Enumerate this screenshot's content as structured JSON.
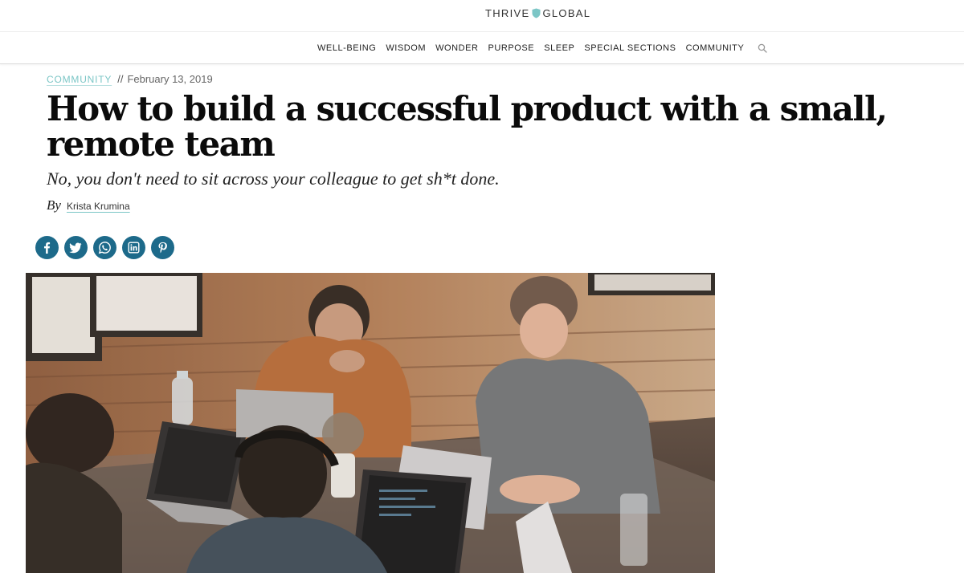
{
  "header": {
    "logo_left": "THRIVE",
    "logo_right": "GLOBAL"
  },
  "nav": {
    "items": [
      {
        "label": "WELL-BEING"
      },
      {
        "label": "WISDOM"
      },
      {
        "label": "WONDER"
      },
      {
        "label": "PURPOSE"
      },
      {
        "label": "SLEEP"
      },
      {
        "label": "SPECIAL SECTIONS"
      },
      {
        "label": "COMMUNITY"
      }
    ],
    "search_icon": "search-icon"
  },
  "article": {
    "category": "COMMUNITY",
    "separator": "//",
    "date": "February 13, 2019",
    "title": "How to build a successful product with a small, remote team",
    "subtitle": "No, you don't need to sit across your colleague to get sh*t done.",
    "by_label": "By",
    "author": "Krista Krumina"
  },
  "share": {
    "icons": [
      "facebook-icon",
      "twitter-icon",
      "whatsapp-icon",
      "linkedin-icon",
      "pinterest-icon"
    ]
  },
  "colors": {
    "accent_teal": "#7cc6c6",
    "share_blue": "#1d6a8a"
  }
}
